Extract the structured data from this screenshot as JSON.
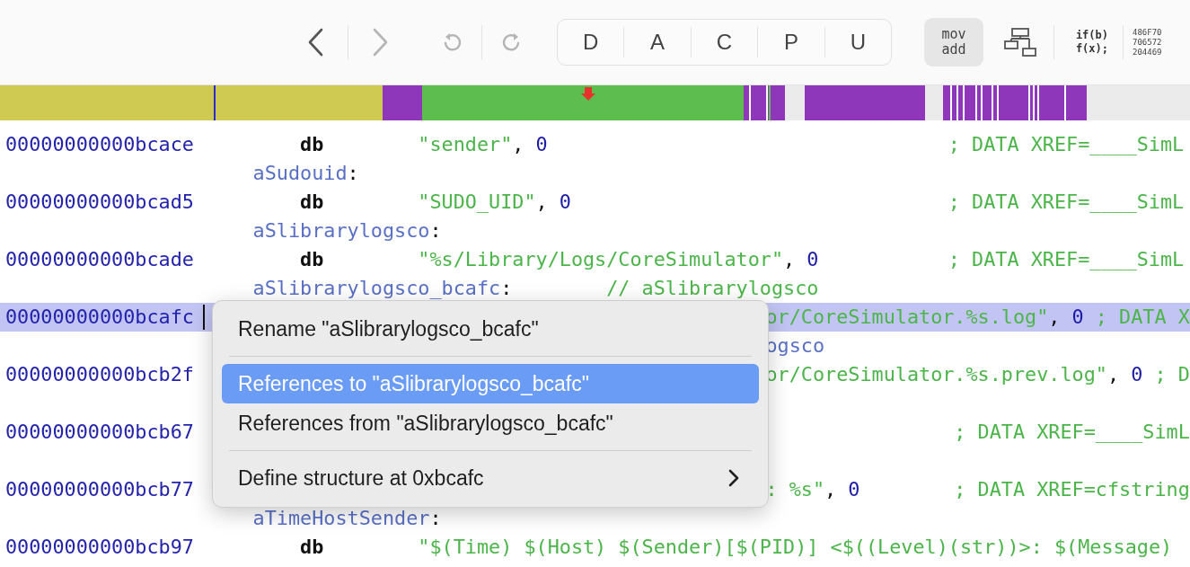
{
  "toolbar": {
    "history": [
      {
        "kind": "back",
        "disabled": false
      },
      {
        "kind": "forward",
        "disabled": true
      }
    ],
    "undo_redo": [
      {
        "kind": "undo",
        "disabled": true
      },
      {
        "kind": "redo",
        "disabled": true
      }
    ],
    "modes": [
      "D",
      "A",
      "C",
      "P",
      "U"
    ],
    "assembly_button": [
      "mov",
      "add"
    ],
    "pseudocode_button": [
      "if(b)",
      "f(x);"
    ],
    "hex_button": [
      "486F70",
      "706572",
      "204469"
    ]
  },
  "lines": [
    {
      "kind": "instruction",
      "selected": false,
      "address": "00000000000bcace",
      "mnemonic": "db",
      "operand": [
        {
          "text": "\"sender\"",
          "kind": "string"
        },
        {
          "text": ", ",
          "kind": "punct"
        },
        {
          "text": "0",
          "kind": "number"
        }
      ],
      "comment": "; DATA XREF=____SimL"
    },
    {
      "kind": "label",
      "name": "aSudouid",
      "suffix": ":"
    },
    {
      "kind": "instruction",
      "selected": false,
      "address": "00000000000bcad5",
      "mnemonic": "db",
      "operand": [
        {
          "text": "\"SUDO_UID\"",
          "kind": "string"
        },
        {
          "text": ", ",
          "kind": "punct"
        },
        {
          "text": "0",
          "kind": "number"
        }
      ],
      "comment": "; DATA XREF=____SimL"
    },
    {
      "kind": "label",
      "name": "aSlibrarylogsco",
      "suffix": ":"
    },
    {
      "kind": "instruction",
      "selected": false,
      "address": "00000000000bcade",
      "mnemonic": "db",
      "operand": [
        {
          "text": "\"%s/Library/Logs/CoreSimulator\"",
          "kind": "string"
        },
        {
          "text": ", ",
          "kind": "punct"
        },
        {
          "text": "0",
          "kind": "number"
        }
      ],
      "comment": "; DATA XREF=____SimL"
    },
    {
      "kind": "label",
      "name": "aSlibrarylogsco_bcafc",
      "suffix": ":",
      "comment": "// aSlibrarylogsco"
    },
    {
      "kind": "covered",
      "selected": true,
      "address": "00000000000bcafc",
      "operand": [
        {
          "text": "or/CoreSimulator.%s.log\"",
          "kind": "string"
        },
        {
          "text": ", ",
          "kind": "punct"
        },
        {
          "text": "0",
          "kind": "number"
        }
      ],
      "comment": "; DATA X"
    },
    {
      "kind": "covered_label",
      "name": "ogsco"
    },
    {
      "kind": "covered",
      "selected": false,
      "address": "00000000000bcb2f",
      "operand": [
        {
          "text": "or/CoreSimulator.%s.prev.log\"",
          "kind": "string"
        },
        {
          "text": ", ",
          "kind": "punct"
        },
        {
          "text": "0",
          "kind": "number"
        }
      ],
      "comment": "; D"
    },
    {
      "kind": "blank"
    },
    {
      "kind": "covered",
      "selected": false,
      "address": "00000000000bcb67",
      "comment": "; DATA XREF=____SimL"
    },
    {
      "kind": "blank"
    },
    {
      "kind": "covered",
      "selected": false,
      "address": "00000000000bcb77",
      "operand": [
        {
          "text": ": %s\"",
          "kind": "string"
        },
        {
          "text": ", ",
          "kind": "punct"
        },
        {
          "text": "0",
          "kind": "number"
        }
      ],
      "comment": "; DATA XREF=cfstring"
    },
    {
      "kind": "label",
      "name": "aTimeHostSender",
      "suffix": ":"
    },
    {
      "kind": "instruction",
      "selected": false,
      "address": "00000000000bcb97",
      "mnemonic": "db",
      "operand": [
        {
          "text": "\"$(Time) $(Host) $(Sender)[$(PID)] <$((Level)(str))>: $(Message)",
          "kind": "string"
        }
      ]
    }
  ],
  "context_menu": [
    {
      "kind": "item",
      "label": "Rename \"aSlibrarylogsco_bcafc\"",
      "selected": false,
      "submenu": false
    },
    {
      "kind": "separator"
    },
    {
      "kind": "item",
      "label": "References to \"aSlibrarylogsco_bcafc\"",
      "selected": true,
      "submenu": false
    },
    {
      "kind": "item",
      "label": "References from \"aSlibrarylogsco_bcafc\"",
      "selected": false,
      "submenu": false
    },
    {
      "kind": "separator"
    },
    {
      "kind": "item",
      "label": "Define structure at 0xbcafc",
      "selected": false,
      "submenu": true
    }
  ]
}
